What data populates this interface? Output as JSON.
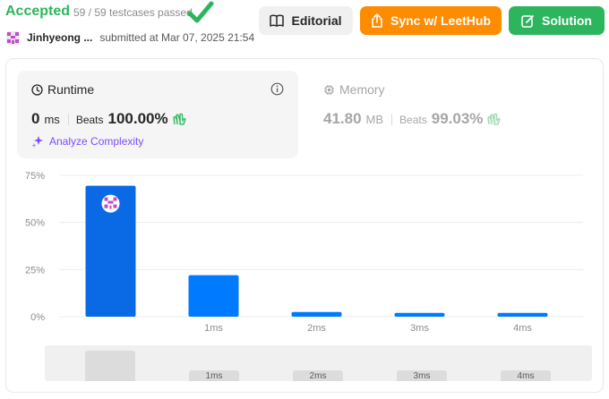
{
  "header": {
    "status": "Accepted",
    "testcases": "59 / 59 testcases passed",
    "username": "Jinhyeong ...",
    "submitted": "submitted at Mar 07, 2025 21:54"
  },
  "buttons": {
    "editorial": "Editorial",
    "leethub": "Sync w/ LeetHub",
    "solution": "Solution"
  },
  "runtime": {
    "title": "Runtime",
    "value": "0",
    "unit": "ms",
    "beats_label": "Beats",
    "beats_value": "100.00%",
    "analyze": "Analyze Complexity"
  },
  "memory": {
    "title": "Memory",
    "value": "41.80",
    "unit": "MB",
    "beats_label": "Beats",
    "beats_value": "99.03%"
  },
  "colors": {
    "accepted": "#2db55d",
    "leethub": "#ff8c00",
    "bar_highlight": "#0a6ae6",
    "bar": "#007aff",
    "analyze": "#7c4dff"
  },
  "chart_data": {
    "type": "bar",
    "categories": [
      "0ms",
      "1ms",
      "2ms",
      "3ms",
      "4ms"
    ],
    "category_labels": [
      "",
      "1ms",
      "2ms",
      "3ms",
      "4ms"
    ],
    "values": [
      69.5,
      22.0,
      2.5,
      2.0,
      2.0
    ],
    "highlight_index": 0,
    "yticks": [
      "75%",
      "50%",
      "25%",
      "0%"
    ],
    "ylim": [
      0,
      75
    ],
    "grid": true
  },
  "scroller": {
    "labels": [
      "1ms",
      "2ms",
      "3ms",
      "4ms"
    ]
  }
}
